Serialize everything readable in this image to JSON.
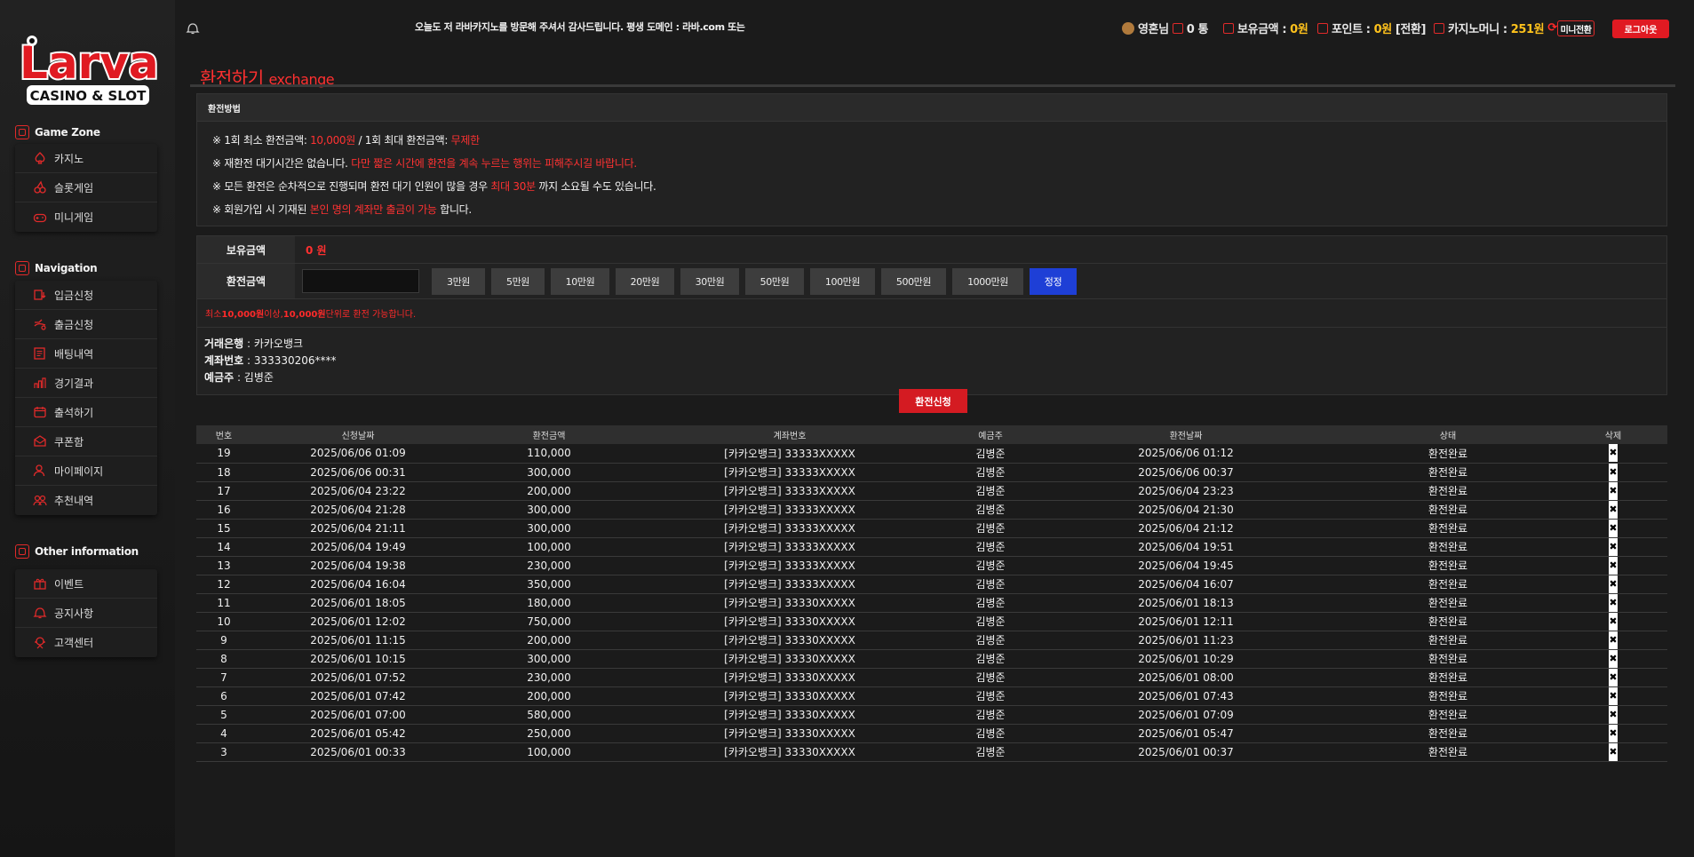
{
  "logo": {
    "main": "Larva",
    "sub": "CASINO & SLOT"
  },
  "sidebar": {
    "sections": [
      {
        "title": "Game Zone",
        "items": [
          {
            "label": "카지노",
            "icon": "spade-icon"
          },
          {
            "label": "슬롯게임",
            "icon": "cherry-icon"
          },
          {
            "label": "미니게임",
            "icon": "gamepad-icon"
          }
        ]
      },
      {
        "title": "Navigation",
        "items": [
          {
            "label": "입금신청",
            "icon": "deposit-icon"
          },
          {
            "label": "출금신청",
            "icon": "withdraw-icon"
          },
          {
            "label": "배팅내역",
            "icon": "betting-history-icon"
          },
          {
            "label": "경기결과",
            "icon": "chart-icon"
          },
          {
            "label": "출석하기",
            "icon": "calendar-icon"
          },
          {
            "label": "쿠폰함",
            "icon": "coupon-icon"
          },
          {
            "label": "마이페이지",
            "icon": "user-icon"
          },
          {
            "label": "추천내역",
            "icon": "users-icon"
          }
        ]
      },
      {
        "title": "Other information",
        "items": [
          {
            "label": "이벤트",
            "icon": "gift-icon"
          },
          {
            "label": "공지사항",
            "icon": "notice-icon"
          },
          {
            "label": "고객센터",
            "icon": "support-icon"
          }
        ]
      }
    ]
  },
  "topbar": {
    "marquee": "오늘도 저 라바카지노를 방문해 주셔서 감사드립니다. 평생 도메인 : 라바.com 또는",
    "user_name": "영혼님",
    "messages": "0 통",
    "balance_label": "보유금액 :",
    "balance_value": "0원",
    "points_label": "포인트 :",
    "points_value": "0원",
    "points_convert": "[전환]",
    "casino_label": "카지노머니 :",
    "casino_value": "251원",
    "mini_exchange": "미니전환",
    "logout": "로그아웃"
  },
  "page": {
    "title": "환전하기",
    "subtitle": "exchange",
    "method_title": "환전방법",
    "rules": [
      {
        "pre": "※ 1회 최소 환전금액: ",
        "hl": "10,000원",
        "mid": " / 1회 최대 환전금액: ",
        "hl2": "무제한",
        "post": ""
      },
      {
        "pre": "※ 재환전 대기시간은 없습니다. ",
        "hl": "다만 짧은 시간에 환전을 계속 누르는 행위는 피해주시길 바랍니다.",
        "mid": "",
        "hl2": "",
        "post": ""
      },
      {
        "pre": "※ 모든 환전은 순차적으로 진행되며 환전 대기 인원이 많을 경우 ",
        "hl": "최대 30분",
        "mid": " 까지 소요될 수도 있습니다.",
        "hl2": "",
        "post": ""
      },
      {
        "pre": "※ 회원가입 시 기재된 ",
        "hl": "본인 명의 계좌만 출금이 가능",
        "mid": " 합니다.",
        "hl2": "",
        "post": ""
      }
    ]
  },
  "form": {
    "balance_label": "보유금액",
    "balance_value": "0 원",
    "amount_label": "환전금액",
    "amount_value": "",
    "quick_buttons": [
      "3만원",
      "5만원",
      "10만원",
      "20만원",
      "30만원",
      "50만원",
      "100만원",
      "500만원",
      "1000만원"
    ],
    "reset_button": "정정",
    "note_pre": "최소 ",
    "note_min": "10,000원",
    "note_mid": " 이상, ",
    "note_unit": "10,000원",
    "note_post": " 단위로 환전 가능합니다.",
    "bank_label": "거래은행",
    "bank_value": "카카오뱅크",
    "account_label": "계좌번호",
    "account_value": "333330206****",
    "holder_label": "예금주",
    "holder_value": "김병준",
    "submit": "환전신청"
  },
  "history": {
    "columns": [
      "번호",
      "신청날짜",
      "환전금액",
      "계좌번호",
      "예금주",
      "환전날짜",
      "상태",
      "삭제"
    ],
    "rows": [
      [
        "19",
        "2025/06/06 01:09",
        "110,000",
        "[카카오뱅크] 33333XXXXX",
        "김병준",
        "2025/06/06 01:12",
        "환전완료"
      ],
      [
        "18",
        "2025/06/06 00:31",
        "300,000",
        "[카카오뱅크] 33333XXXXX",
        "김병준",
        "2025/06/06 00:37",
        "환전완료"
      ],
      [
        "17",
        "2025/06/04 23:22",
        "200,000",
        "[카카오뱅크] 33333XXXXX",
        "김병준",
        "2025/06/04 23:23",
        "환전완료"
      ],
      [
        "16",
        "2025/06/04 21:28",
        "300,000",
        "[카카오뱅크] 33333XXXXX",
        "김병준",
        "2025/06/04 21:30",
        "환전완료"
      ],
      [
        "15",
        "2025/06/04 21:11",
        "300,000",
        "[카카오뱅크] 33333XXXXX",
        "김병준",
        "2025/06/04 21:12",
        "환전완료"
      ],
      [
        "14",
        "2025/06/04 19:49",
        "100,000",
        "[카카오뱅크] 33333XXXXX",
        "김병준",
        "2025/06/04 19:51",
        "환전완료"
      ],
      [
        "13",
        "2025/06/04 19:38",
        "230,000",
        "[카카오뱅크] 33333XXXXX",
        "김병준",
        "2025/06/04 19:45",
        "환전완료"
      ],
      [
        "12",
        "2025/06/04 16:04",
        "350,000",
        "[카카오뱅크] 33333XXXXX",
        "김병준",
        "2025/06/04 16:07",
        "환전완료"
      ],
      [
        "11",
        "2025/06/01 18:05",
        "180,000",
        "[카카오뱅크] 33330XXXXX",
        "김병준",
        "2025/06/01 18:13",
        "환전완료"
      ],
      [
        "10",
        "2025/06/01 12:02",
        "750,000",
        "[카카오뱅크] 33330XXXXX",
        "김병준",
        "2025/06/01 12:11",
        "환전완료"
      ],
      [
        "9",
        "2025/06/01 11:15",
        "200,000",
        "[카카오뱅크] 33330XXXXX",
        "김병준",
        "2025/06/01 11:23",
        "환전완료"
      ],
      [
        "8",
        "2025/06/01 10:15",
        "300,000",
        "[카카오뱅크] 33330XXXXX",
        "김병준",
        "2025/06/01 10:29",
        "환전완료"
      ],
      [
        "7",
        "2025/06/01 07:52",
        "230,000",
        "[카카오뱅크] 33330XXXXX",
        "김병준",
        "2025/06/01 08:00",
        "환전완료"
      ],
      [
        "6",
        "2025/06/01 07:42",
        "200,000",
        "[카카오뱅크] 33330XXXXX",
        "김병준",
        "2025/06/01 07:43",
        "환전완료"
      ],
      [
        "5",
        "2025/06/01 07:00",
        "580,000",
        "[카카오뱅크] 33330XXXXX",
        "김병준",
        "2025/06/01 07:09",
        "환전완료"
      ],
      [
        "4",
        "2025/06/01 05:42",
        "250,000",
        "[카카오뱅크] 33330XXXXX",
        "김병준",
        "2025/06/01 05:47",
        "환전완료"
      ],
      [
        "3",
        "2025/06/01 00:33",
        "100,000",
        "[카카오뱅크] 33330XXXXX",
        "김병준",
        "2025/06/01 00:37",
        "환전완료"
      ]
    ],
    "delete_glyph": "✖"
  },
  "colors": {
    "accent": "#e01a22",
    "highlight": "#ff3030",
    "yellow": "#ffc21c",
    "blue": "#1e3fd6"
  }
}
